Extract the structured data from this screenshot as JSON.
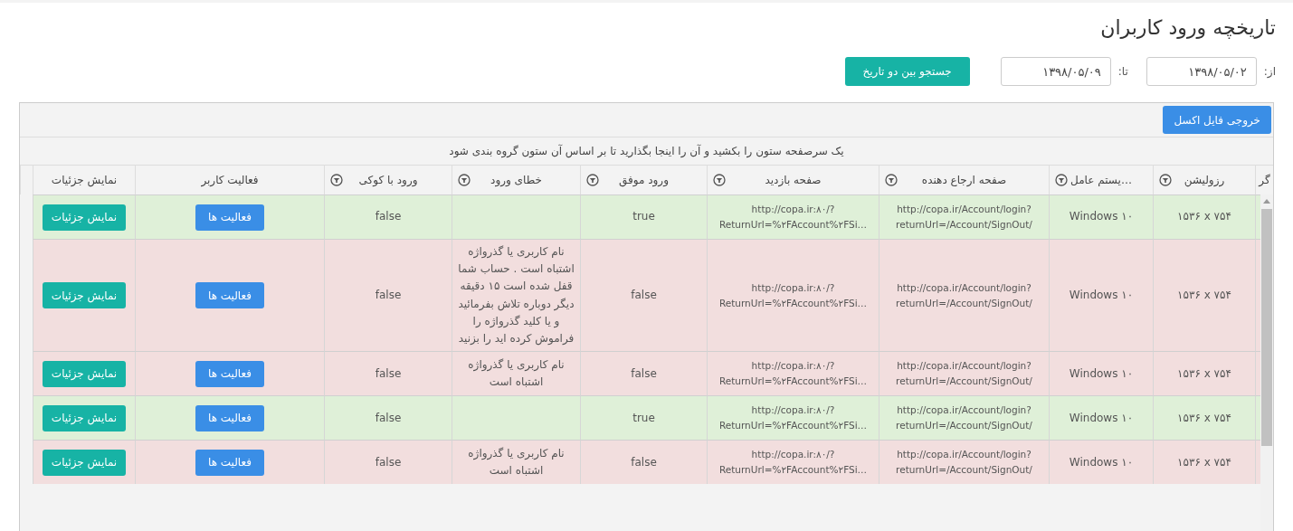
{
  "page_title": "تاریخچه ورود کاربران",
  "date_filter": {
    "from_label": "از:",
    "from_value": "۱۳۹۸/۰۵/۰۲",
    "to_label": "تا:",
    "to_value": "۱۳۹۸/۰۵/۰۹",
    "search_button": "جستجو بین دو تاریخ"
  },
  "toolbar": {
    "export_button": "خروجی فایل اکسل"
  },
  "group_panel": {
    "hint": "یک سرصفحه ستون را بکشید و آن را اینجا بگذارید تا بر اساس آن ستون گروه بندی شود"
  },
  "table": {
    "columns": [
      {
        "label": "گر",
        "filter": false
      },
      {
        "label": "رزولیشن",
        "filter": true
      },
      {
        "label": "…یستم عامل",
        "filter": true
      },
      {
        "label": "صفحه ارجاع دهنده",
        "filter": true
      },
      {
        "label": "صفحه بازدید",
        "filter": true
      },
      {
        "label": "ورود موفق",
        "filter": true
      },
      {
        "label": "خطای ورود",
        "filter": true
      },
      {
        "label": "ورود با کوکی",
        "filter": true
      },
      {
        "label": "فعالیت کاربر",
        "filter": false
      },
      {
        "label": "نمایش جزئیات",
        "filter": false
      }
    ],
    "rows": [
      {
        "success": true,
        "resolution": "۱۵۳۶ x ۷۵۴",
        "os": "Windows ۱۰",
        "referrer": "http://copa.ir/Account/login? returnUrl=/Account/SignOut/",
        "page": "http://copa.ir:۸۰/? ReturnUrl=%۲FAccount%۲FSi…",
        "login_ok": "true",
        "cookie": "false",
        "activity_button": "فعالیت ها",
        "details_button": "نمایش جزئیات"
      },
      {
        "success": false,
        "resolution": "۱۵۳۶ x ۷۵۴",
        "os": "Windows ۱۰",
        "referrer": "http://copa.ir/Account/login? returnUrl=/Account/SignOut/",
        "page": "http://copa.ir:۸۰/? ReturnUrl=%۲FAccount%۲FSi…",
        "login_ok": "false",
        "error": "نام کاربری یا گذرواژه اشتباه است . حساب شما قفل شده است ۱۵ دقیقه دیگر دوباره تلاش بفرمائید و یا کلید گذرواژه را فراموش کرده اید را بزنید",
        "cookie": "false",
        "activity_button": "فعالیت ها",
        "details_button": "نمایش جزئیات"
      },
      {
        "success": false,
        "resolution": "۱۵۳۶ x ۷۵۴",
        "os": "Windows ۱۰",
        "referrer": "http://copa.ir/Account/login? returnUrl=/Account/SignOut/",
        "page": "http://copa.ir:۸۰/? ReturnUrl=%۲FAccount%۲FSi…",
        "login_ok": "false",
        "error": "نام کاربری یا گذرواژه اشتباه است",
        "cookie": "false",
        "activity_button": "فعالیت ها",
        "details_button": "نمایش جزئیات"
      },
      {
        "success": true,
        "resolution": "۱۵۳۶ x ۷۵۴",
        "os": "Windows ۱۰",
        "referrer": "http://copa.ir/Account/login? returnUrl=/Account/SignOut/",
        "page": "http://copa.ir:۸۰/? ReturnUrl=%۲FAccount%۲FSi…",
        "login_ok": "true",
        "cookie": "false",
        "activity_button": "فعالیت ها",
        "details_button": "نمایش جزئیات"
      },
      {
        "success": false,
        "resolution": "۱۵۳۶ x ۷۵۴",
        "os": "Windows ۱۰",
        "referrer": "http://copa.ir/Account/login? returnUrl=/Account/SignOut/",
        "page": "http://copa.ir:۸۰/? ReturnUrl=%۲FAccount%۲FSi…",
        "login_ok": "false",
        "error": "نام کاربری یا گذرواژه اشتباه است",
        "cookie": "false",
        "activity_button": "فعالیت ها",
        "details_button": "نمایش جزئیات"
      }
    ]
  }
}
